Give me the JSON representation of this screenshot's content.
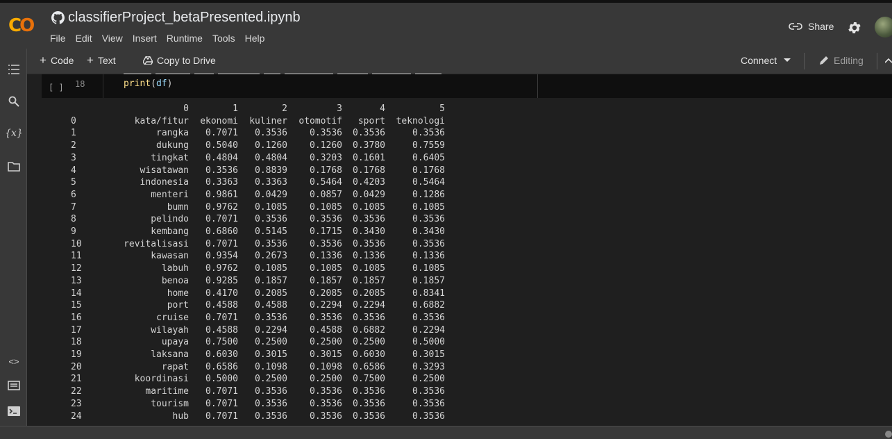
{
  "header": {
    "notebook_title": "classifierProject_betaPresented.ipynb",
    "menu": [
      "File",
      "Edit",
      "View",
      "Insert",
      "Runtime",
      "Tools",
      "Help"
    ],
    "share_label": "Share"
  },
  "toolbar": {
    "code_label": "Code",
    "text_label": "Text",
    "copy_label": "Copy to Drive",
    "connect_label": "Connect",
    "editing_label": "Editing"
  },
  "cell": {
    "run_indicator": "[ ]",
    "line_number": "18",
    "code_func": "print",
    "code_arg": "df"
  },
  "output": {
    "columns": [
      "",
      "0",
      "1",
      "2",
      "3",
      "4",
      "5"
    ],
    "rows": [
      [
        "0",
        "kata/fitur",
        "ekonomi",
        "kuliner",
        "otomotif",
        "sport",
        "teknologi"
      ],
      [
        "1",
        "rangka",
        "0.7071",
        "0.3536",
        "0.3536",
        "0.3536",
        "0.3536"
      ],
      [
        "2",
        "dukung",
        "0.5040",
        "0.1260",
        "0.1260",
        "0.3780",
        "0.7559"
      ],
      [
        "3",
        "tingkat",
        "0.4804",
        "0.4804",
        "0.3203",
        "0.1601",
        "0.6405"
      ],
      [
        "4",
        "wisatawan",
        "0.3536",
        "0.8839",
        "0.1768",
        "0.1768",
        "0.1768"
      ],
      [
        "5",
        "indonesia",
        "0.3363",
        "0.3363",
        "0.5464",
        "0.4203",
        "0.5464"
      ],
      [
        "6",
        "menteri",
        "0.9861",
        "0.0429",
        "0.0857",
        "0.0429",
        "0.1286"
      ],
      [
        "7",
        "bumn",
        "0.9762",
        "0.1085",
        "0.1085",
        "0.1085",
        "0.1085"
      ],
      [
        "8",
        "pelindo",
        "0.7071",
        "0.3536",
        "0.3536",
        "0.3536",
        "0.3536"
      ],
      [
        "9",
        "kembang",
        "0.6860",
        "0.5145",
        "0.1715",
        "0.3430",
        "0.3430"
      ],
      [
        "10",
        "revitalisasi",
        "0.7071",
        "0.3536",
        "0.3536",
        "0.3536",
        "0.3536"
      ],
      [
        "11",
        "kawasan",
        "0.9354",
        "0.2673",
        "0.1336",
        "0.1336",
        "0.1336"
      ],
      [
        "12",
        "labuh",
        "0.9762",
        "0.1085",
        "0.1085",
        "0.1085",
        "0.1085"
      ],
      [
        "13",
        "benoa",
        "0.9285",
        "0.1857",
        "0.1857",
        "0.1857",
        "0.1857"
      ],
      [
        "14",
        "home",
        "0.4170",
        "0.2085",
        "0.2085",
        "0.2085",
        "0.8341"
      ],
      [
        "15",
        "port",
        "0.4588",
        "0.4588",
        "0.2294",
        "0.2294",
        "0.6882"
      ],
      [
        "16",
        "cruise",
        "0.7071",
        "0.3536",
        "0.3536",
        "0.3536",
        "0.3536"
      ],
      [
        "17",
        "wilayah",
        "0.4588",
        "0.2294",
        "0.4588",
        "0.6882",
        "0.2294"
      ],
      [
        "18",
        "upaya",
        "0.7500",
        "0.2500",
        "0.2500",
        "0.2500",
        "0.5000"
      ],
      [
        "19",
        "laksana",
        "0.6030",
        "0.3015",
        "0.3015",
        "0.6030",
        "0.3015"
      ],
      [
        "20",
        "rapat",
        "0.6586",
        "0.1098",
        "0.1098",
        "0.6586",
        "0.3293"
      ],
      [
        "21",
        "koordinasi",
        "0.5000",
        "0.2500",
        "0.2500",
        "0.7500",
        "0.2500"
      ],
      [
        "22",
        "maritime",
        "0.7071",
        "0.3536",
        "0.3536",
        "0.3536",
        "0.3536"
      ],
      [
        "23",
        "tourism",
        "0.7071",
        "0.3536",
        "0.3536",
        "0.3536",
        "0.3536"
      ],
      [
        "24",
        "hub",
        "0.7071",
        "0.3536",
        "0.3536",
        "0.3536",
        "0.3536"
      ]
    ]
  },
  "icons": {
    "sidebar": [
      "toc-icon",
      "search-icon",
      "variables-icon",
      "folder-icon",
      "code-snippets-icon",
      "command-palette-icon",
      "terminal-icon"
    ]
  },
  "colors": {
    "logo_yellow": "#f9ab00",
    "logo_orange": "#e8710a",
    "code_keyword": "#ffe08a"
  }
}
